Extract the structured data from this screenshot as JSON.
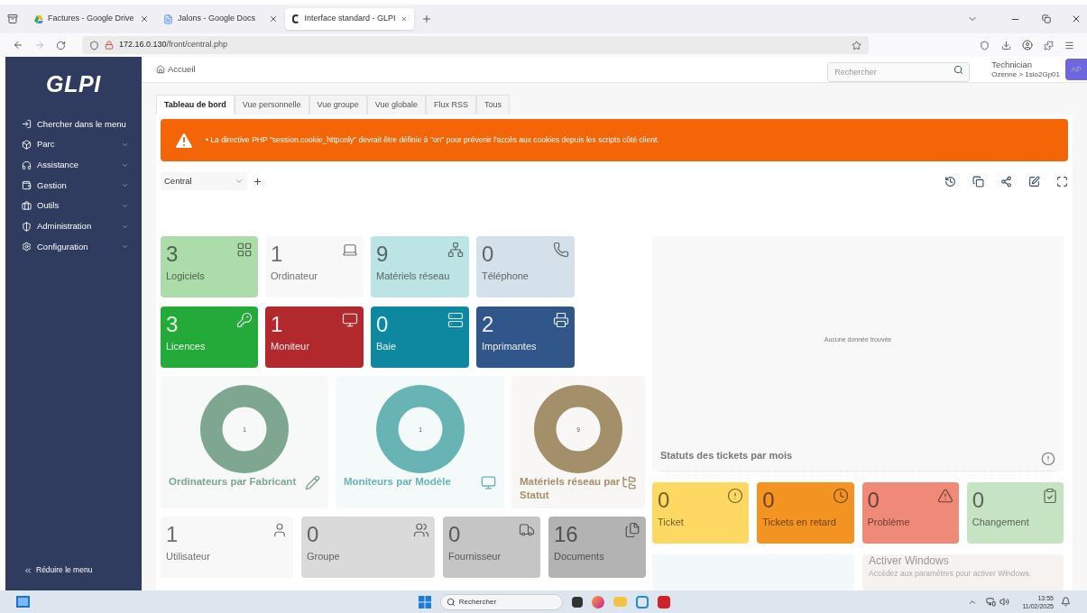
{
  "browser": {
    "tabs": [
      {
        "title": "Factures - Google Drive",
        "selected": false
      },
      {
        "title": "Jalons - Google Docs",
        "selected": false
      },
      {
        "title": "Interface standard - GLPI",
        "selected": true
      }
    ],
    "address": {
      "host": "172.16.0.130",
      "path": "/front/central.php"
    }
  },
  "sidebar": {
    "logo": "GLPI",
    "items": [
      {
        "label": "Chercher dans le menu",
        "expandable": false
      },
      {
        "label": "Parc",
        "expandable": true
      },
      {
        "label": "Assistance",
        "expandable": true
      },
      {
        "label": "Gestion",
        "expandable": true
      },
      {
        "label": "Outils",
        "expandable": true
      },
      {
        "label": "Administration",
        "expandable": true
      },
      {
        "label": "Configuration",
        "expandable": true
      }
    ],
    "collapse": "Réduire le menu"
  },
  "header": {
    "breadcrumb": "Accueil",
    "search": {
      "placeholder": "Rechercher"
    },
    "user": {
      "profile": "Technician",
      "entity": "Ozenne > 1sio2Gp01",
      "initials": "AP"
    }
  },
  "tabs": [
    {
      "label": "Tableau de bord",
      "selected": true
    },
    {
      "label": "Vue personnelle",
      "selected": false
    },
    {
      "label": "Vue groupe",
      "selected": false
    },
    {
      "label": "Vue globale",
      "selected": false
    },
    {
      "label": "Flux RSS",
      "selected": false
    },
    {
      "label": "Tous",
      "selected": false
    }
  ],
  "alert": {
    "message": "• La directive PHP \"session.cookie_httponly\" devrait être définie à \"on\" pour prévenir l'accès aux cookies depuis les scripts côté client."
  },
  "dashboard_select": {
    "value": "Central"
  },
  "tiles": [
    {
      "count": "3",
      "label": "Logiciels",
      "color": "#addcab"
    },
    {
      "count": "1",
      "label": "Ordinateur",
      "color": "#f8f8f8"
    },
    {
      "count": "9",
      "label": "Matériels réseau",
      "color": "#bde4e4"
    },
    {
      "count": "0",
      "label": "Téléphone",
      "color": "#d4e0ea"
    },
    {
      "count": "3",
      "label": "Licences",
      "color": "#24aa38"
    },
    {
      "count": "1",
      "label": "Moniteur",
      "color": "#b2292d"
    },
    {
      "count": "0",
      "label": "Baie",
      "color": "#0e88a0"
    },
    {
      "count": "2",
      "label": "Imprimantes",
      "color": "#31578a"
    }
  ],
  "donuts": [
    {
      "color": "#7ea691",
      "total": "1",
      "title": "Ordinateurs par Fabricant"
    },
    {
      "color": "#68b3b4",
      "total": "1",
      "title": "Moniteurs par Modèle"
    },
    {
      "color": "#a48f6b",
      "total": "9",
      "title": "Matériels réseau par Statut"
    }
  ],
  "bottom_tiles": [
    {
      "count": "1",
      "label": "Utilisateur",
      "color": "#f8f8f8"
    },
    {
      "count": "0",
      "label": "Groupe",
      "color": "#dadada"
    },
    {
      "count": "0",
      "label": "Fournisseur",
      "color": "#c5c5c5"
    },
    {
      "count": "16",
      "label": "Documents",
      "color": "#b3b3b3"
    }
  ],
  "ticket_panel": {
    "empty": "Aucune donnée trouvée",
    "title": "Statuts des tickets par mois"
  },
  "ticket_tiles": [
    {
      "count": "0",
      "label": "Ticket",
      "color": "#fdd963"
    },
    {
      "count": "0",
      "label": "Tickets en retard",
      "color": "#f39322"
    },
    {
      "count": "0",
      "label": "Problème",
      "color": "#f08a78"
    },
    {
      "count": "0",
      "label": "Changement",
      "color": "#c6e3c4"
    }
  ],
  "os_notice": {
    "title": "Activer Windows",
    "text": "Accédez aux paramètres pour activer Windows."
  },
  "taskbar": {
    "search": "Rechercher",
    "time": "13:55",
    "date": "11/02/2025"
  }
}
